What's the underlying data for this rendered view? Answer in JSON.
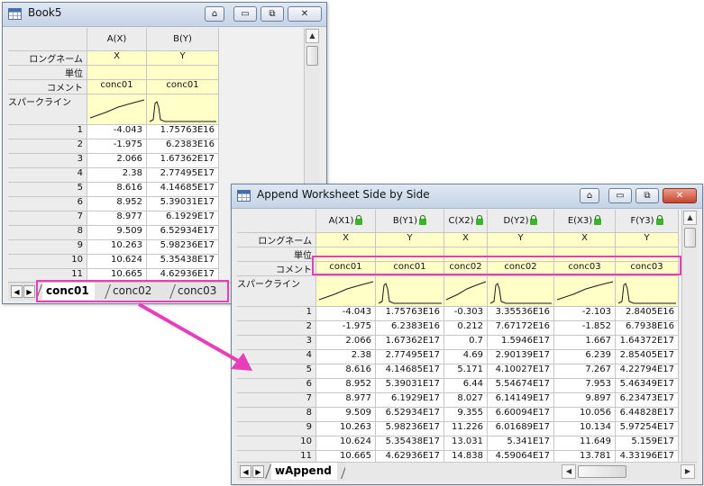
{
  "book": {
    "title": "Book5",
    "title_buttons": [
      "⌂",
      "▭",
      "⧉",
      "✕"
    ],
    "columns": [
      {
        "header": "A(X)",
        "long_name": "X",
        "unit": "",
        "comment": "conc01"
      },
      {
        "header": "B(Y)",
        "long_name": "Y",
        "unit": "",
        "comment": "conc01"
      }
    ],
    "row_labels": {
      "long_name": "ロングネーム",
      "unit": "単位",
      "comment": "コメント",
      "sparkline": "スパークライン"
    },
    "row_numbers": [
      "1",
      "2",
      "3",
      "4",
      "5",
      "6",
      "7",
      "8",
      "9",
      "10",
      "11"
    ],
    "rows": [
      [
        "-4.043",
        "1.75763E16"
      ],
      [
        "-1.975",
        "6.2383E16"
      ],
      [
        "2.066",
        "1.67362E17"
      ],
      [
        "2.38",
        "2.77495E17"
      ],
      [
        "8.616",
        "4.14685E17"
      ],
      [
        "8.952",
        "5.39031E17"
      ],
      [
        "8.977",
        "6.1929E17"
      ],
      [
        "9.509",
        "6.52934E17"
      ],
      [
        "10.263",
        "5.98236E17"
      ],
      [
        "10.624",
        "5.35438E17"
      ],
      [
        "10.665",
        "4.62936E17"
      ]
    ],
    "tabs": [
      "conc01",
      "conc02",
      "conc03"
    ],
    "nav": [
      "◀",
      "▶"
    ]
  },
  "append": {
    "title": "Append Worksheet Side by Side",
    "title_buttons": [
      "⌂",
      "▭",
      "⧉",
      "✕"
    ],
    "columns": [
      {
        "header": "A(X1)",
        "long_name": "X",
        "unit": "",
        "comment": "conc01"
      },
      {
        "header": "B(Y1)",
        "long_name": "Y",
        "unit": "",
        "comment": "conc01"
      },
      {
        "header": "C(X2)",
        "long_name": "X",
        "unit": "",
        "comment": "conc02"
      },
      {
        "header": "D(Y2)",
        "long_name": "Y",
        "unit": "",
        "comment": "conc02"
      },
      {
        "header": "E(X3)",
        "long_name": "X",
        "unit": "",
        "comment": "conc03"
      },
      {
        "header": "F(Y3)",
        "long_name": "Y",
        "unit": "",
        "comment": "conc03"
      }
    ],
    "row_labels": {
      "long_name": "ロングネーム",
      "unit": "単位",
      "comment": "コメント",
      "sparkline": "スパークライン"
    },
    "row_numbers": [
      "1",
      "2",
      "3",
      "4",
      "5",
      "6",
      "7",
      "8",
      "9",
      "10",
      "11"
    ],
    "rows": [
      [
        "-4.043",
        "1.75763E16",
        "-0.303",
        "3.35536E16",
        "-2.103",
        "2.8405E16"
      ],
      [
        "-1.975",
        "6.2383E16",
        "0.212",
        "7.67172E16",
        "-1.852",
        "6.7938E16"
      ],
      [
        "2.066",
        "1.67362E17",
        "0.7",
        "1.5946E17",
        "1.667",
        "1.64372E17"
      ],
      [
        "2.38",
        "2.77495E17",
        "4.69",
        "2.90139E17",
        "6.239",
        "2.85405E17"
      ],
      [
        "8.616",
        "4.14685E17",
        "5.171",
        "4.10027E17",
        "7.267",
        "4.22794E17"
      ],
      [
        "8.952",
        "5.39031E17",
        "6.44",
        "5.54674E17",
        "7.953",
        "5.46349E17"
      ],
      [
        "8.977",
        "6.1929E17",
        "8.027",
        "6.14149E17",
        "9.897",
        "6.23473E17"
      ],
      [
        "9.509",
        "6.52934E17",
        "9.355",
        "6.60094E17",
        "10.056",
        "6.44828E17"
      ],
      [
        "10.263",
        "5.98236E17",
        "11.226",
        "6.01689E17",
        "10.134",
        "5.97254E17"
      ],
      [
        "10.624",
        "5.35438E17",
        "13.031",
        "5.341E17",
        "11.649",
        "5.159E17"
      ],
      [
        "10.665",
        "4.62936E17",
        "14.838",
        "4.59064E17",
        "13.781",
        "4.33196E17"
      ]
    ],
    "tabs": [
      "wAppend"
    ],
    "nav": [
      "◀",
      "▶"
    ]
  },
  "colors": {
    "highlight": "#e63fb9",
    "arrow": "#e63fb9",
    "sparkline": "#1a1a1a",
    "meta_row": "#ffffc8"
  }
}
